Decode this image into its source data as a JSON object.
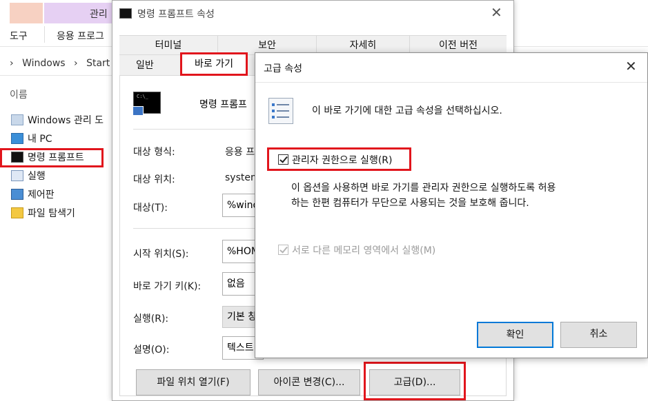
{
  "explorer": {
    "ribbon_tab_manage": "관리",
    "ribbon_left": "도구",
    "ribbon_right": "응용 프로그",
    "address": [
      "›",
      "Windows",
      "›",
      "Start"
    ],
    "name_column": "이름",
    "nav_items": [
      {
        "label": "Windows 관리 도",
        "icon": "admin-tools-icon"
      },
      {
        "label": "내 PC",
        "icon": "pc-icon"
      },
      {
        "label": "명령 프롬프트",
        "icon": "cmd-icon"
      },
      {
        "label": "실행",
        "icon": "run-icon"
      },
      {
        "label": "제어판",
        "icon": "control-panel-icon"
      },
      {
        "label": "파일 탐색기",
        "icon": "file-explorer-icon"
      }
    ]
  },
  "props": {
    "title": "명령 프롬프트 속성",
    "tabs_row1": [
      "터미널",
      "보안",
      "자세히",
      "이전 버전"
    ],
    "tabs_row2": [
      "일반",
      "바로 가기"
    ],
    "active_tab": "바로 가기",
    "shortcut_name": "명령 프롬프",
    "icon_text": "C:\\_",
    "rows": {
      "target_type_label": "대상 형식:",
      "target_type_value": "응용 프",
      "target_location_label": "대상 위치:",
      "target_location_value": "system",
      "target_label": "대상(T):",
      "target_value": "%wind",
      "start_in_label": "시작 위치(S):",
      "start_in_value": "%HOM",
      "shortcut_key_label": "바로 가기 키(K):",
      "shortcut_key_value": "없음",
      "run_label": "실행(R):",
      "run_value": "기본 창",
      "comment_label": "설명(O):",
      "comment_value": "텍스트"
    },
    "buttons": {
      "open_location": "파일 위치 열기(F)",
      "change_icon": "아이콘 변경(C)...",
      "advanced": "고급(D)..."
    }
  },
  "advanced": {
    "title": "고급 속성",
    "description": "이 바로 가기에 대한 고급 속성을 선택하십시오.",
    "run_as_admin_label": "관리자 권한으로 실행(R)",
    "run_as_admin_checked": true,
    "help_line1": "이 옵션을 사용하면 바로 가기를 관리자 권한으로 실행하도록 허용",
    "help_line2": "하는 한편 컴퓨터가 무단으로 사용되는 것을 보호해 줍니다.",
    "separate_memory_label": "서로 다른 메모리 영역에서 실행(M)",
    "separate_memory_checked": true,
    "separate_memory_enabled": false,
    "ok_label": "확인",
    "cancel_label": "취소"
  },
  "colors": {
    "highlight": "#e1151c",
    "default_button_border": "#0078d7"
  }
}
